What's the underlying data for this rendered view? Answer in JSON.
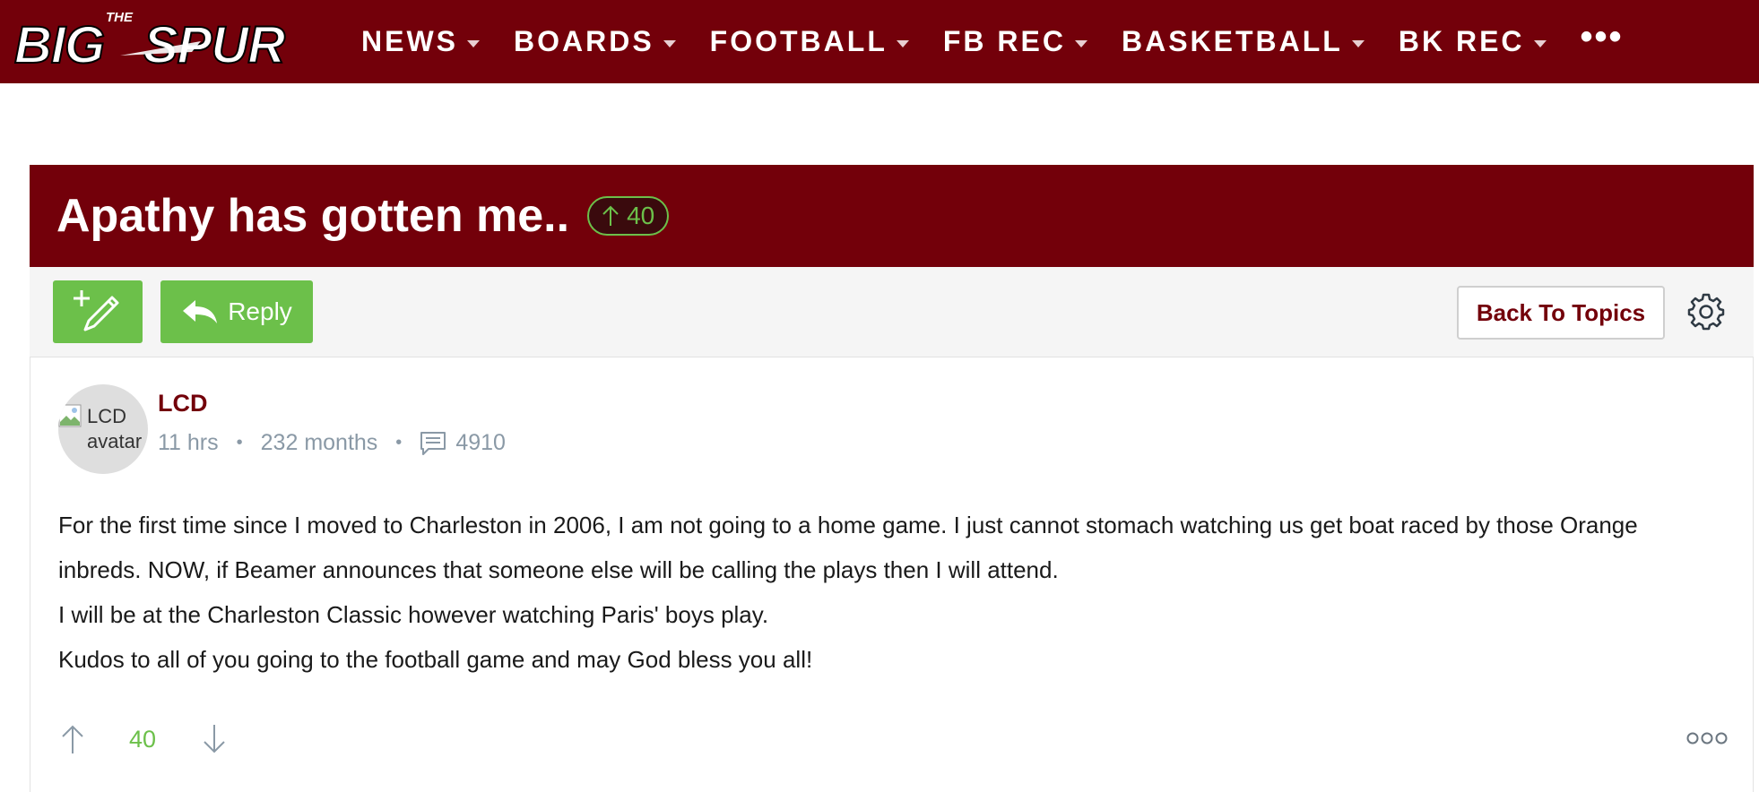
{
  "site": {
    "logo_text": "THE BIGSPUR",
    "nav": [
      {
        "label": "NEWS"
      },
      {
        "label": "BOARDS"
      },
      {
        "label": "FOOTBALL"
      },
      {
        "label": "FB REC"
      },
      {
        "label": "BASKETBALL"
      },
      {
        "label": "BK REC"
      }
    ],
    "more_label": "•••"
  },
  "thread": {
    "title": "Apathy has gotten me..",
    "score": "40"
  },
  "toolbar": {
    "reply_label": "Reply",
    "back_label": "Back To Topics"
  },
  "post": {
    "avatar_alt_1": "LCD",
    "avatar_alt_2": "avatar",
    "username": "LCD",
    "time": "11 hrs",
    "tenure": "232 months",
    "post_count": "4910",
    "paragraphs": [
      "For the first time since I moved to Charleston in 2006, I am not going to a home game. I just cannot stomach watching us get boat raced by those Orange inbreds. NOW, if Beamer announces that someone else will be calling the plays then I will attend.",
      "I will be at the Charleston Classic however watching Paris' boys play.",
      "Kudos to all of you going to the football game and may God bless you all!"
    ],
    "score": "40"
  },
  "colors": {
    "brand": "#73000a",
    "accent_green": "#6cc04a",
    "meta_gray": "#8a99a6"
  },
  "icons": [
    "pencil-plus-icon",
    "reply-arrow-icon",
    "gear-icon",
    "comment-icon",
    "arrow-up-icon",
    "arrow-down-icon",
    "more-dots-icon",
    "broken-image-icon"
  ]
}
